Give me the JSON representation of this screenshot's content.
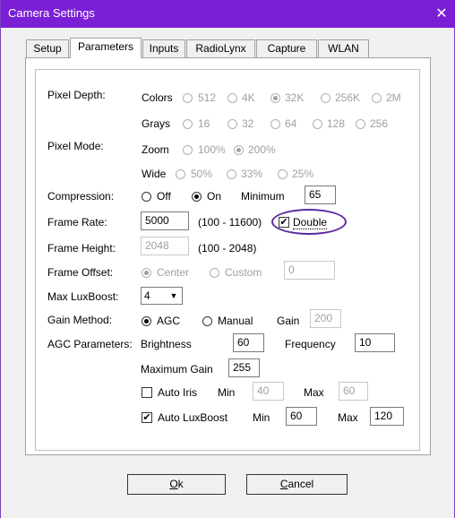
{
  "window": {
    "title": "Camera Settings",
    "close_glyph": "✕"
  },
  "tabs": [
    "Setup",
    "Parameters",
    "Inputs",
    "RadioLynx",
    "Capture",
    "WLAN"
  ],
  "pixel_depth": {
    "label": "Pixel Depth:",
    "colors_label": "Colors",
    "colors_options": [
      "512",
      "4K",
      "32K",
      "256K",
      "2M"
    ],
    "grays_label": "Grays",
    "grays_options": [
      "16",
      "32",
      "64",
      "128",
      "256"
    ]
  },
  "pixel_mode": {
    "label": "Pixel Mode:",
    "zoom_label": "Zoom",
    "zoom_options": [
      "100%",
      "200%"
    ],
    "wide_label": "Wide",
    "wide_options": [
      "50%",
      "33%",
      "25%"
    ]
  },
  "compression": {
    "label": "Compression:",
    "off": "Off",
    "on": "On",
    "minimum_label": "Minimum",
    "minimum_value": "65"
  },
  "frame_rate": {
    "label": "Frame Rate:",
    "value": "5000",
    "range": "(100 - 11600)",
    "double_label": "Double",
    "double_checked": "✔"
  },
  "frame_height": {
    "label": "Frame Height:",
    "value": "2048",
    "range": "(100 - 2048)"
  },
  "frame_offset": {
    "label": "Frame Offset:",
    "center": "Center",
    "custom": "Custom",
    "value": "0"
  },
  "max_luxboost": {
    "label": "Max LuxBoost:",
    "value": "4",
    "arrow": "▼"
  },
  "gain_method": {
    "label": "Gain Method:",
    "agc": "AGC",
    "manual": "Manual",
    "gain_label": "Gain",
    "gain_value": "200"
  },
  "agc": {
    "label": "AGC Parameters:",
    "brightness_label": "Brightness",
    "brightness_value": "60",
    "frequency_label": "Frequency",
    "frequency_value": "10",
    "max_gain_label": "Maximum Gain",
    "max_gain_value": "255",
    "auto_iris_label": "Auto Iris",
    "auto_iris_min_label": "Min",
    "auto_iris_min": "40",
    "auto_iris_max_label": "Max",
    "auto_iris_max": "60",
    "auto_lux_label": "Auto LuxBoost",
    "auto_lux_checked": "✔",
    "auto_lux_min_label": "Min",
    "auto_lux_min": "60",
    "auto_lux_max_label": "Max",
    "auto_lux_max": "120"
  },
  "buttons": {
    "ok_prefix": "O",
    "ok_rest": "k",
    "cancel_prefix": "C",
    "cancel_rest": "ancel"
  }
}
